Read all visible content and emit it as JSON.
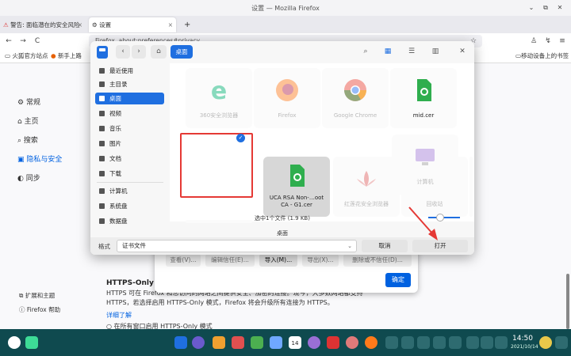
{
  "window": {
    "title": "设置 — Mozilla Firefox",
    "minimize": "⌄",
    "restore": "⧉",
    "close": "✕"
  },
  "tabs": [
    {
      "label": "警告: 面临潜在的安全风险",
      "close": "×"
    },
    {
      "label": "设置",
      "close": "×"
    }
  ],
  "new_tab": "+",
  "nav": {
    "back": "←",
    "forward": "→",
    "reload": "C",
    "url": "about:preferences#privacy",
    "url_prefix": "Firefox",
    "star": "☆",
    "account": "♙",
    "extension": "↯",
    "menu": "≡"
  },
  "bookmarks": [
    "火狐官方站点",
    "新手上路"
  ],
  "mobile_bookmarks": "移动设备上的书签",
  "prefs_nav": [
    "常规",
    "主页",
    "搜索",
    "隐私与安全",
    "同步"
  ],
  "prefs_bottom": [
    "扩展和主题",
    "Firefox 帮助"
  ],
  "https": {
    "title": "HTTPS-Only 模",
    "desc": "HTTPS 可在 Firefox 和您访问的网站之间提供安全、加密的连接。现今，大多数网站都支持 HTTPS，若选择启用 HTTPS-Only 模式，Firefox 将会升级所有连接为 HTTPS。",
    "link": "详细了解",
    "radio": "在所有窗口启用 HTTPS-Only 模式"
  },
  "cert_dialog": {
    "buttons": [
      "查看(V)...",
      "编辑信任(E)...",
      "导入(M)...",
      "导出(X)...",
      "删除或不信任(D)..."
    ],
    "confirm": "确定"
  },
  "file_dialog": {
    "path": "桌面",
    "back": "‹",
    "forward": "›",
    "home": "⌂",
    "search": "⌕",
    "icon_view": "▦",
    "list_view": "☰",
    "detail_view": "▥",
    "close": "✕",
    "sidebar": [
      "最近使用",
      "主目录",
      "桌面",
      "视频",
      "音乐",
      "图片",
      "文档",
      "下载",
      "计算机",
      "系统盘",
      "数据盘"
    ],
    "files": [
      {
        "label": "360安全浏览器",
        "icon": "360-icon",
        "color": "#2bbf8a"
      },
      {
        "label": "Firefox",
        "icon": "firefox-icon",
        "color": "#ff7a1a"
      },
      {
        "label": "Google Chrome",
        "icon": "chrome-icon",
        "color": "#4285f4"
      },
      {
        "label": "mid.cer",
        "icon": "certificate-icon",
        "color": "#2fae4e"
      },
      {
        "label": "UCA RSA Non-…oot CA - G1.cer",
        "icon": "certificate-icon",
        "color": "#2fae4e"
      },
      {
        "label": "红莲花安全浏览器",
        "icon": "lotus-icon",
        "color": "#e06060"
      },
      {
        "label": "回收站",
        "icon": "trash-icon",
        "color": "#7fbf4f"
      },
      {
        "label": "计算机",
        "icon": "computer-icon",
        "color": "#9a6fd6"
      }
    ],
    "checkmark": "✓",
    "status": "选中1个文件 (1.9 KB)",
    "filename": "桌面",
    "format_label": "格式",
    "format_value": "证书文件",
    "format_arrow": "⌄",
    "cancel": "取消",
    "open": "打开"
  },
  "taskbar": {
    "time": "14:50",
    "date": "2021/10/14",
    "calendar_day": "14"
  }
}
